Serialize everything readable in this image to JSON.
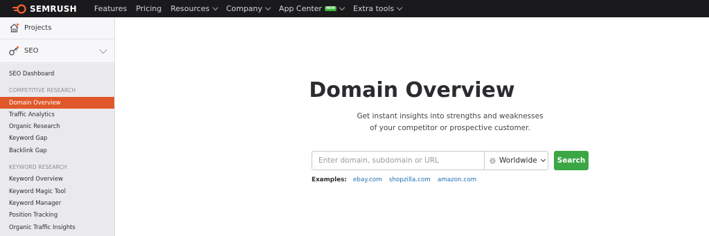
{
  "brand": {
    "name": "SEMRUSH",
    "accent": "#ff642d"
  },
  "topnav": {
    "items": [
      {
        "label": "Features",
        "dropdown": false
      },
      {
        "label": "Pricing",
        "dropdown": false
      },
      {
        "label": "Resources",
        "dropdown": true
      },
      {
        "label": "Company",
        "dropdown": true
      },
      {
        "label": "App Center",
        "dropdown": true,
        "badge": "NEW"
      },
      {
        "label": "Extra tools",
        "dropdown": true
      }
    ]
  },
  "sidebar": {
    "projects_label": "Projects",
    "seo_label": "SEO",
    "menu": {
      "dashboard": "SEO Dashboard",
      "competitive_section": "COMPETITIVE RESEARCH",
      "competitive_items": [
        "Domain Overview",
        "Traffic Analytics",
        "Organic Research",
        "Keyword Gap",
        "Backlink Gap"
      ],
      "keyword_section": "KEYWORD RESEARCH",
      "keyword_items": [
        "Keyword Overview",
        "Keyword Magic Tool",
        "Keyword Manager",
        "Position Tracking",
        "Organic Traffic Insights"
      ]
    },
    "active_item": "Domain Overview",
    "active_color": "#e0582a"
  },
  "main": {
    "title": "Domain Overview",
    "subtitle_line1": "Get instant insights into strengths and weaknesses",
    "subtitle_line2": "of your competitor or prospective customer.",
    "search": {
      "placeholder": "Enter domain, subdomain or URL",
      "region": "Worldwide",
      "button": "Search",
      "button_color": "#3ba644"
    },
    "examples": {
      "label": "Examples:",
      "links": [
        "ebay.com",
        "shopzilla.com",
        "amazon.com"
      ]
    }
  }
}
